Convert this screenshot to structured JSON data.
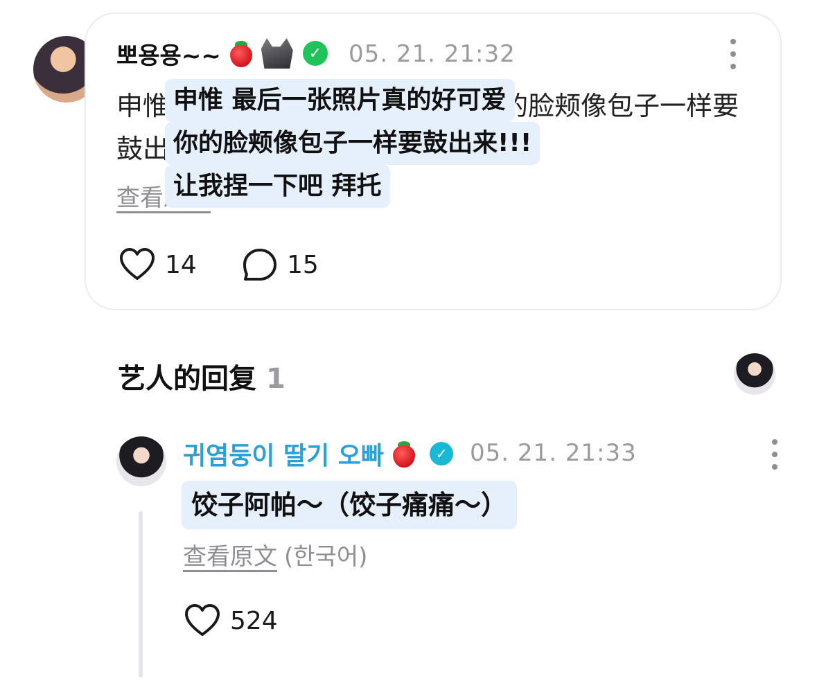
{
  "post": {
    "username": "뽀용용~~",
    "timestamp": "05. 21. 21:32",
    "original_text": "申惟 最后一张照片真的好可爱 你的脸颊像包子一样要鼓出来 你的脸颊像饺子",
    "translation_lines": [
      "申惟 最后一张照片真的好可爱",
      "你的脸颊像包子一样要鼓出来!!!",
      "让我捏一下吧 拜托"
    ],
    "view_original_label": "查看原文",
    "likes": "14",
    "comments": "15"
  },
  "artist_reply_section": {
    "title": "艺人的回复",
    "count": "1"
  },
  "reply": {
    "username": "귀염둥이 딸기 오빠",
    "timestamp": "05. 21. 21:33",
    "translation": "饺子阿帕～（饺子痛痛～）",
    "view_original_label": "查看原文",
    "language": "(한국어)",
    "likes": "524"
  },
  "colors": {
    "translation_highlight": "#e6f0fd",
    "artist_name": "#2a9fd8",
    "verified_badge": "#19b8d6",
    "green_badge": "#20c35a",
    "muted_text": "#9a9a9f"
  },
  "icons": {
    "like": "heart-outline-icon",
    "comment": "speech-bubble-icon",
    "more": "more-vertical-icon",
    "verified": "verified-check-icon"
  }
}
